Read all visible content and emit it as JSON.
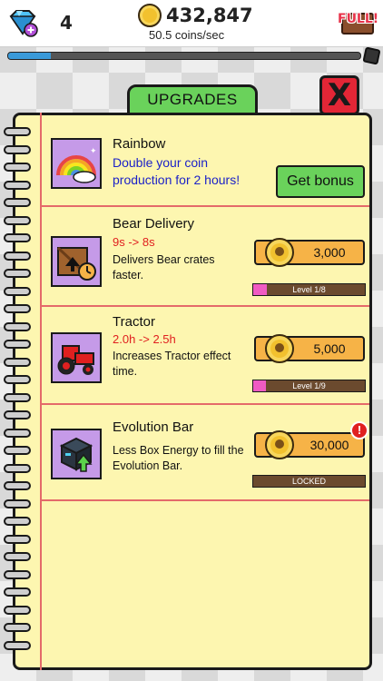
{
  "hud": {
    "gem_icon": "gem-plus-icon",
    "gems": "4",
    "coins_total": "432,847",
    "coins_rate": "50.5 coins/sec",
    "full_label": "FULL!",
    "evolution_progress": 0.12,
    "colors": {
      "evolution_fill": "#3a9ad9",
      "full_label": "#e8334a"
    }
  },
  "panel": {
    "tab_title": "UPGRADES",
    "close_label": "X",
    "colors": {
      "paper": "#fdf6b0",
      "tab": "#6ad25b",
      "close": "#e32636",
      "margin_line": "#e46a6a"
    }
  },
  "upgrades": [
    {
      "title": "Rainbow",
      "description": "Double your coin production for 2 hours!",
      "button_label": "Get bonus",
      "icon": "rainbow-icon"
    },
    {
      "title": "Bear Delivery",
      "delta": "9s -> 8s",
      "description": "Delivers Bear crates faster.",
      "price": "3,000",
      "level_text": "Level 1/8",
      "level_progress": 0.125,
      "icon": "crate-timer-icon"
    },
    {
      "title": "Tractor",
      "delta": "2.0h -> 2.5h",
      "description": "Increases Tractor effect time.",
      "price": "5,000",
      "level_text": "Level 1/9",
      "level_progress": 0.111,
      "icon": "tractor-icon"
    },
    {
      "title": "Evolution Bar",
      "description": "Less Box Energy to fill the Evolution Bar.",
      "price": "30,000",
      "level_text": "LOCKED",
      "alert": "!",
      "icon": "evolution-box-icon"
    }
  ]
}
